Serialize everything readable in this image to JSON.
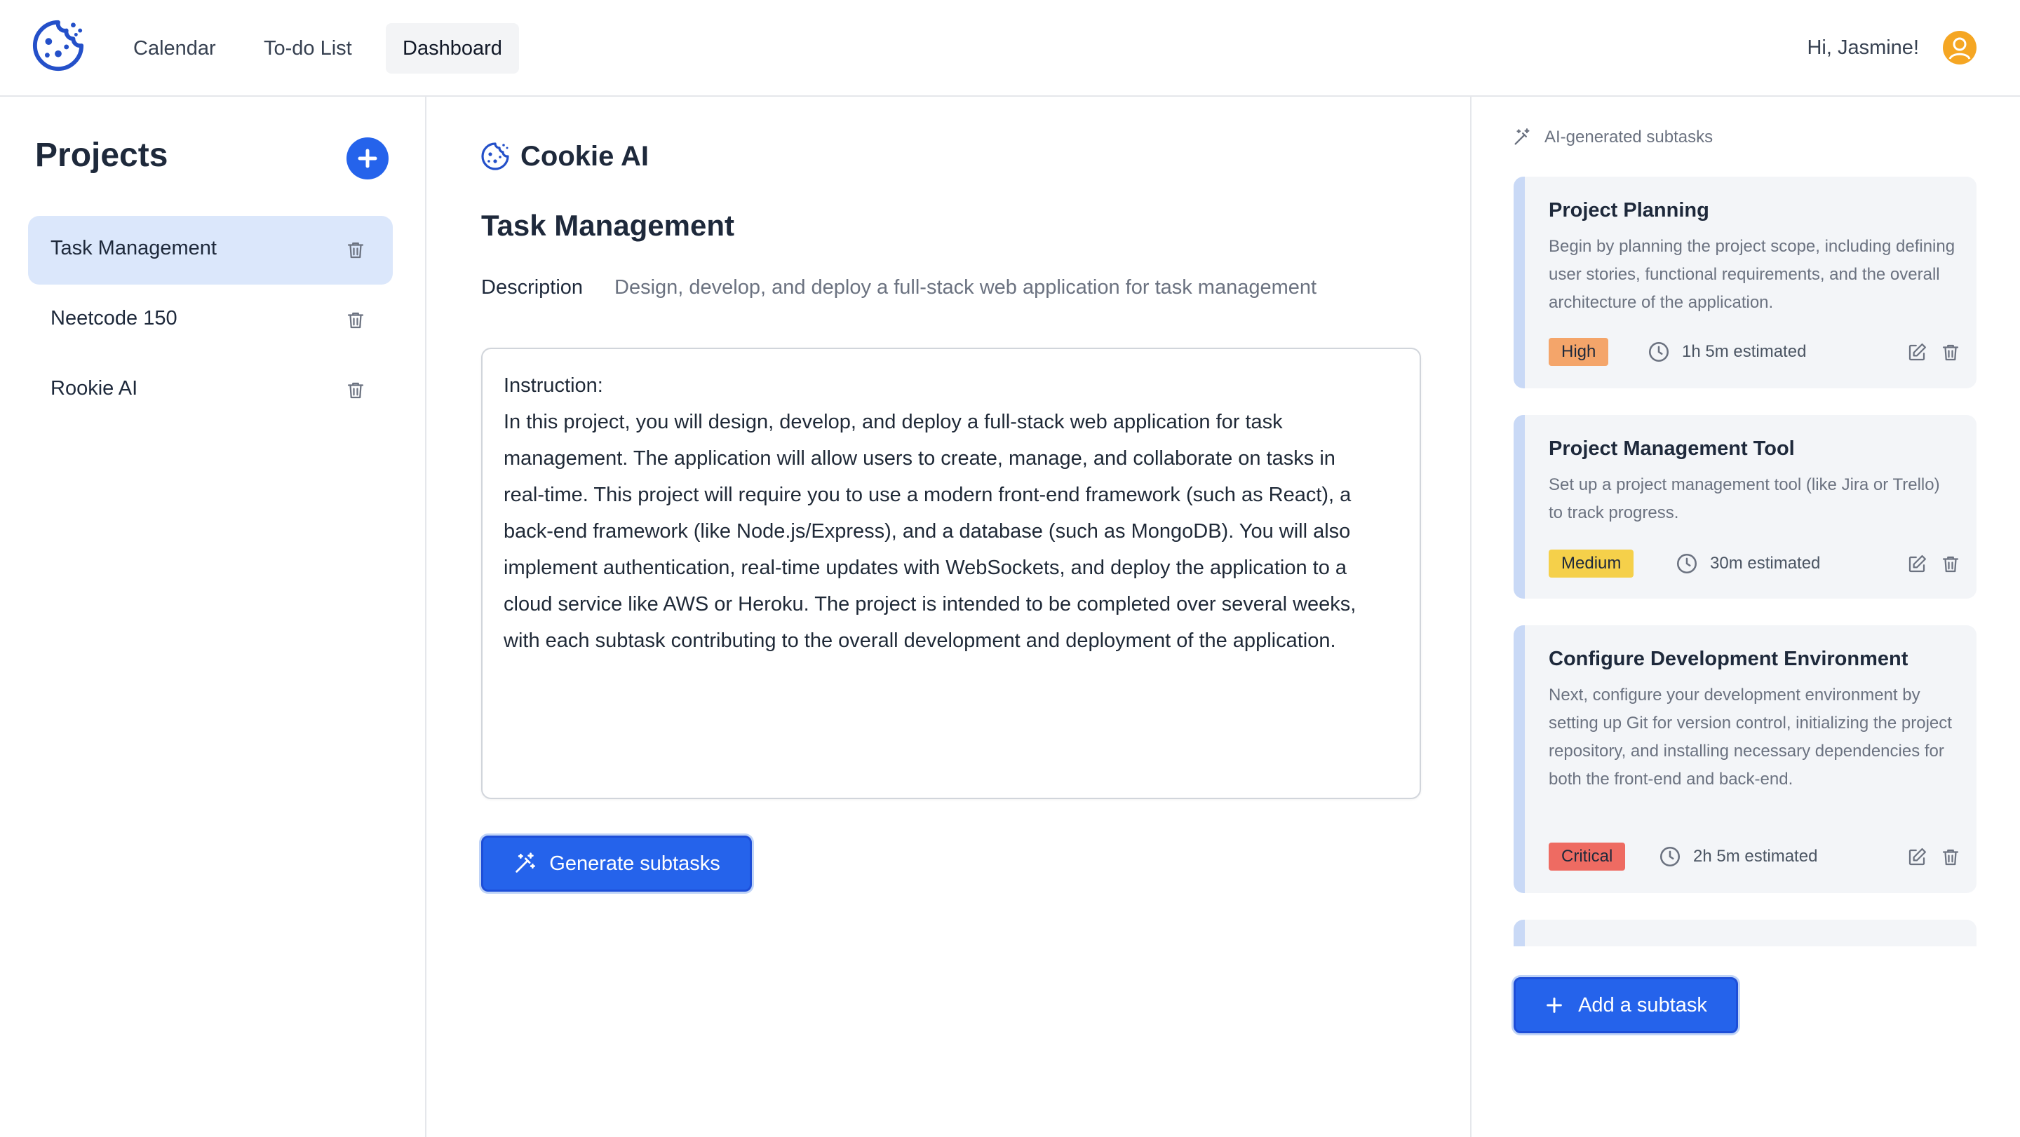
{
  "nav": {
    "items": [
      {
        "label": "Calendar"
      },
      {
        "label": "To-do List"
      },
      {
        "label": "Dashboard",
        "active": true
      }
    ],
    "greeting": "Hi, Jasmine!"
  },
  "sidebar": {
    "title": "Projects",
    "projects": [
      {
        "label": "Task Management",
        "active": true
      },
      {
        "label": "Neetcode 150"
      },
      {
        "label": "Rookie AI"
      }
    ]
  },
  "main": {
    "assistant_title": "Cookie AI",
    "project_title": "Task Management",
    "description_label": "Description",
    "description_value": "Design, develop, and deploy a full-stack web application for task management",
    "instructions": "Instruction:\nIn this project, you will design, develop, and deploy a full-stack web application for task\nmanagement. The application will allow users to create, manage, and collaborate on tasks in\nreal-time. This project will require you to use a modern front-end framework (such as React), a\nback-end framework (like Node.js/Express), and a database (such as MongoDB). You will also\nimplement authentication, real-time updates with WebSockets, and deploy the application to a\ncloud service like AWS or Heroku. The project is intended to be completed over several weeks,\nwith each subtask contributing to the overall development and deployment of the application.",
    "generate_label": "Generate subtasks"
  },
  "subtasks_panel": {
    "header": "AI-generated subtasks",
    "subtasks": [
      {
        "title": "Project Planning",
        "description": "Begin by planning the project scope, including defining user stories, functional requirements, and the overall architecture of the application.",
        "priority": "High",
        "estimate": "1h 5m estimated"
      },
      {
        "title": "Project Management Tool",
        "description": "Set up a project management tool (like Jira or Trello) to track progress.",
        "priority": "Medium",
        "estimate": "30m estimated"
      },
      {
        "title": "Configure Development Environment",
        "description": "Next, configure your development environment by setting up Git for version control, initializing the project repository, and installing necessary dependencies for both the front-end and back-end.",
        "priority": "Critical",
        "estimate": "2h 5m estimated"
      }
    ],
    "add_label": "Add a subtask"
  },
  "colors": {
    "accent": "#2563eb",
    "priority_high": "#f4a56a",
    "priority_medium": "#f5d04a",
    "priority_critical": "#ee6b62",
    "card_bg": "#f3f5f8",
    "card_stripe": "#c9d9f6",
    "active_project_bg": "#dbe7fb"
  },
  "icons": {
    "logo": "cookie-icon",
    "avatar": "user-avatar-icon",
    "add_project": "plus-icon",
    "delete": "trash-icon",
    "edit": "edit-icon",
    "estimate": "clock-icon",
    "ai": "magic-wand-icon"
  }
}
